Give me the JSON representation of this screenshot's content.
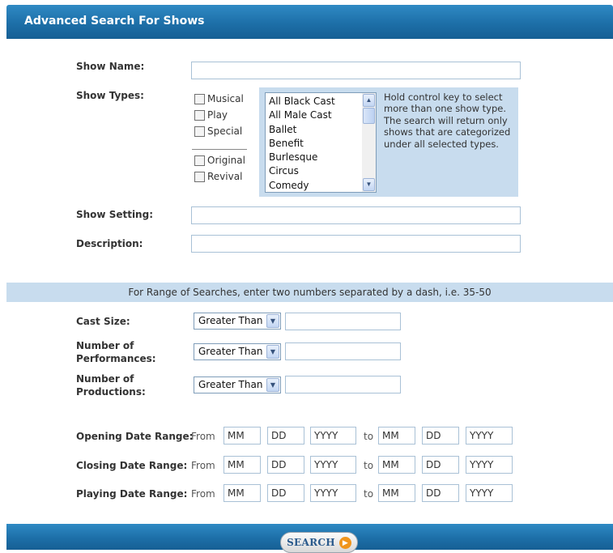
{
  "header": {
    "title": "Advanced Search For Shows"
  },
  "fields": {
    "show_name_label": "Show Name:",
    "show_types_label": "Show Types:",
    "show_setting_label": "Show Setting:",
    "description_label": "Description:"
  },
  "show_types": {
    "checkboxes_a": [
      "Musical",
      "Play",
      "Special"
    ],
    "checkboxes_b": [
      "Original",
      "Revival"
    ],
    "list_options": [
      "All Black Cast",
      "All Male Cast",
      "Ballet",
      "Benefit",
      "Burlesque",
      "Circus",
      "Comedy"
    ],
    "help_text": "Hold control key to select more than one show type. The search will return only shows that are categorized under all selected types."
  },
  "range": {
    "instructions": "For Range of Searches, enter two numbers separated by a dash, i.e. 35-50",
    "cast_size_label": "Cast Size:",
    "performances_label_1": "Number of",
    "performances_label_2": "Performances:",
    "productions_label_1": "Number of",
    "productions_label_2": "Productions:",
    "select_value": "Greater Than"
  },
  "dates": {
    "rows": [
      {
        "label": "Opening Date Range:"
      },
      {
        "label": "Closing Date Range:"
      },
      {
        "label": "Playing Date Range:"
      }
    ],
    "from_label": "From",
    "to_label": "to",
    "mm": "MM",
    "dd": "DD",
    "yyyy": "YYYY"
  },
  "footer": {
    "search_label": "SEARCH"
  },
  "colors": {
    "header_blue": "#1d6fa8",
    "panel_blue": "#c8dcee",
    "go_orange": "#f0951c"
  }
}
